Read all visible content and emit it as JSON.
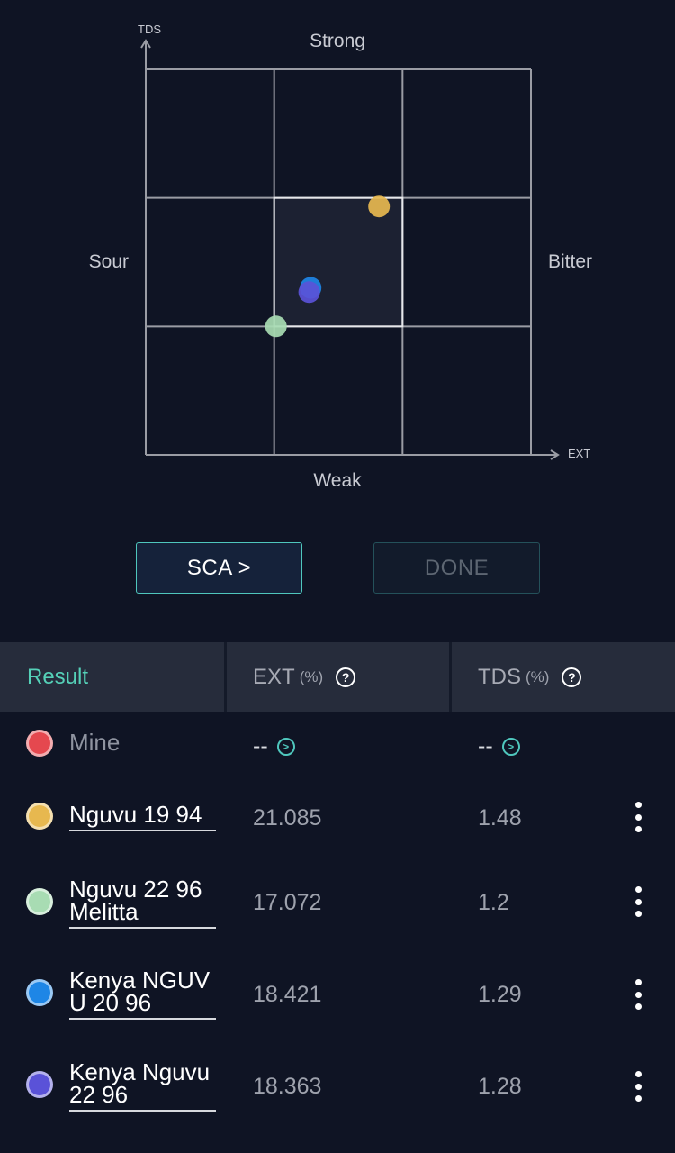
{
  "chart": {
    "y_axis_label": "TDS",
    "x_axis_label": "EXT",
    "top_label": "Strong",
    "bottom_label": "Weak",
    "left_label": "Sour",
    "right_label": "Bitter",
    "grid_color": "#9a9ca4",
    "highlight_color": "#e6e7eb"
  },
  "chart_data": {
    "type": "scatter",
    "series": [
      {
        "name": "Nguvu 19 94",
        "color": "#e7b84f",
        "x": 21.085,
        "y": 1.48
      },
      {
        "name": "Nguvu 22 96 Melitta",
        "color": "#a8dcb3",
        "x": 17.072,
        "y": 1.2
      },
      {
        "name": "Kenya NGUV U 20 96",
        "color": "#1e86e6",
        "x": 18.421,
        "y": 1.29
      },
      {
        "name": "Kenya Nguvu 22 96",
        "color": "#5a52d8",
        "x": 18.363,
        "y": 1.28
      }
    ],
    "xlim": [
      12,
      27
    ],
    "ylim": [
      0.9,
      1.8
    ],
    "grid": true
  },
  "buttons": {
    "sca_label": "SCA >",
    "done_label": "DONE"
  },
  "table": {
    "headers": {
      "result": "Result",
      "ext": "EXT",
      "ext_unit": "(%)",
      "tds": "TDS",
      "tds_unit": "(%)",
      "help_glyph": "?"
    },
    "rows": [
      {
        "name": "Mine",
        "color": "#e5484f",
        "ext": "--",
        "tds": "--",
        "icon": "chevron-right-circle-icon"
      },
      {
        "name": "Nguvu 19 94",
        "color": "#e7b84f",
        "ext": "21.085",
        "tds": "1.48"
      },
      {
        "name": "Nguvu 22 96 Melitta",
        "color": "#a8dcb3",
        "ext": "17.072",
        "tds": "1.2"
      },
      {
        "name": "Kenya NGUV U 20 96",
        "color": "#1e86e6",
        "ext": "18.421",
        "tds": "1.29"
      },
      {
        "name": "Kenya Nguvu 22 96",
        "color": "#5a52d8",
        "ext": "18.363",
        "tds": "1.28"
      }
    ]
  }
}
